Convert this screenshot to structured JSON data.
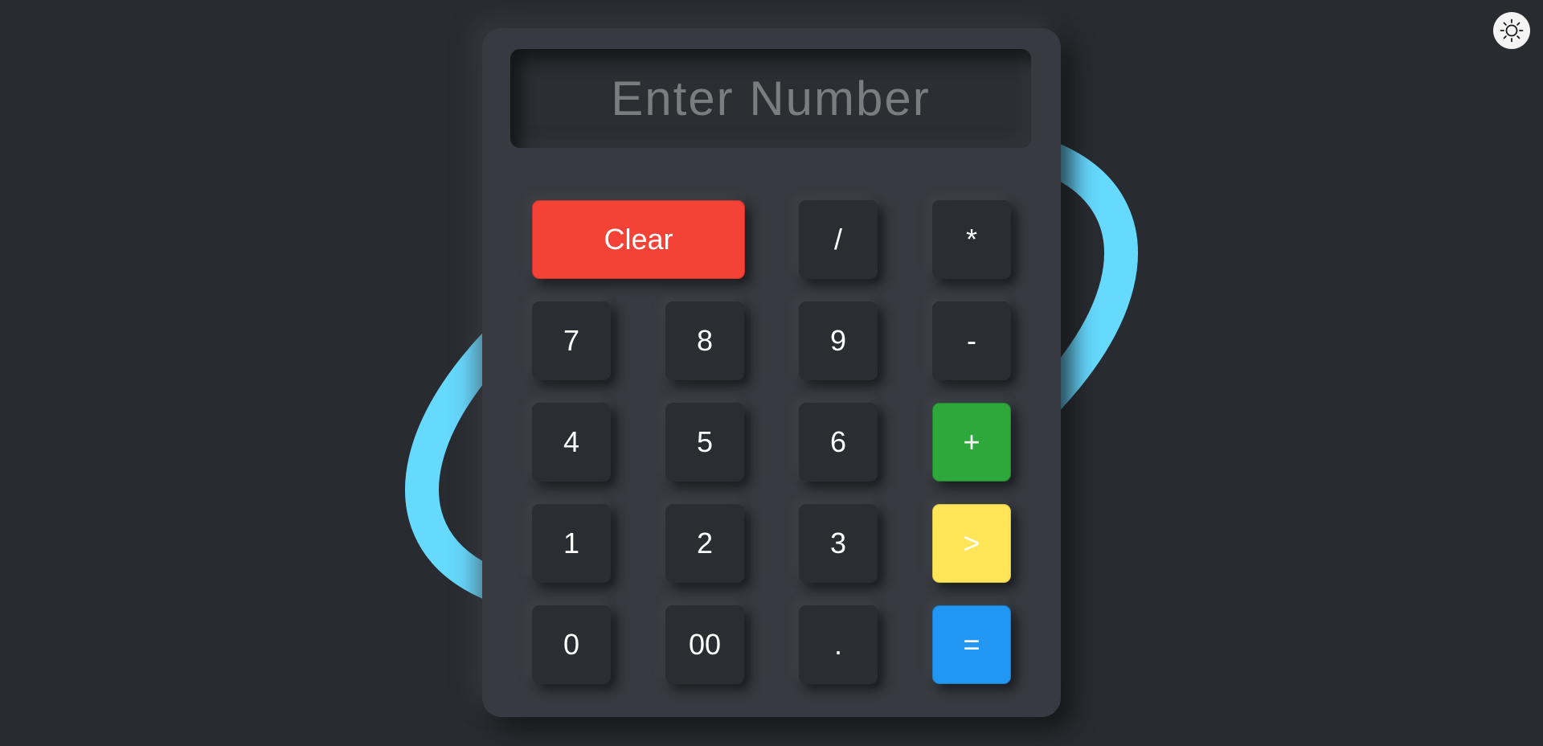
{
  "display": {
    "value": "",
    "placeholder": "Enter Number"
  },
  "keys": {
    "clear": "Clear",
    "divide": "/",
    "multiply": "*",
    "seven": "7",
    "eight": "8",
    "nine": "9",
    "minus": "-",
    "four": "4",
    "five": "5",
    "six": "6",
    "plus": "+",
    "one": "1",
    "two": "2",
    "three": "3",
    "backspace": ">",
    "zero": "0",
    "double_zero": "00",
    "decimal": ".",
    "equals": "="
  },
  "theme_toggle": {
    "icon": "sun-icon"
  },
  "colors": {
    "background": "#282b30",
    "calculator_body": "#373b41",
    "ring_accent": "#66d9ff",
    "clear": "#f44336",
    "plus": "#2ea83a",
    "backspace": "#ffe658",
    "equals": "#2196f3"
  }
}
